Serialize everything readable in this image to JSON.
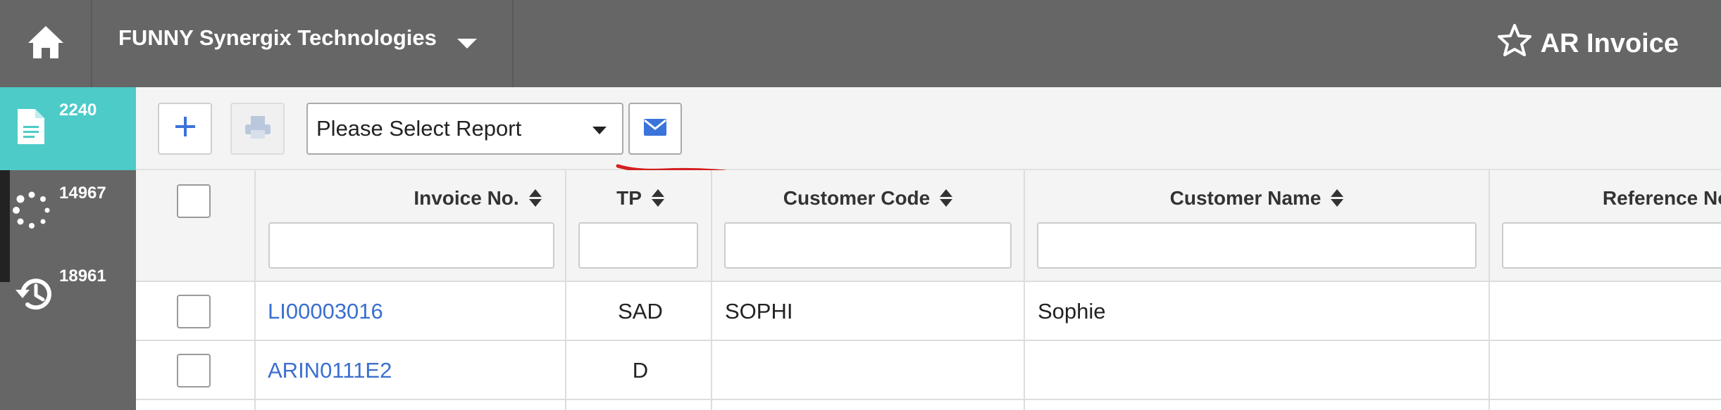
{
  "header": {
    "company_name": "FUNNY Synergix Technologies",
    "page_title": "AR Invoice",
    "icons": {
      "home": "home-icon",
      "company_dropdown": "caret-down-icon",
      "favorite": "star-outline-icon"
    }
  },
  "sidebar": {
    "items": [
      {
        "icon": "document-icon",
        "count": "2240",
        "active": true
      },
      {
        "icon": "spinner-icon",
        "count": "14967",
        "active": false
      },
      {
        "icon": "history-icon",
        "count": "18961",
        "active": false
      }
    ]
  },
  "toolbar": {
    "add_icon": "plus-icon",
    "print_icon": "printer-icon",
    "report_select": {
      "selected": "Please Select Report"
    },
    "email_icon": "envelope-icon"
  },
  "colors": {
    "header_bg": "#666666",
    "sidebar_active": "#4ccbc8",
    "link": "#3b6fcf",
    "accent_blue": "#3a73d9",
    "annotation_red": "#d42020"
  },
  "grid": {
    "columns": [
      {
        "label": "Invoice No."
      },
      {
        "label": "TP"
      },
      {
        "label": "Customer Code"
      },
      {
        "label": "Customer Name"
      },
      {
        "label": "Reference No."
      }
    ],
    "rows": [
      {
        "invoice_no": "LI00003016",
        "tp": "SAD",
        "customer_code": "SOPHI",
        "customer_name": "Sophie",
        "reference_no": ""
      },
      {
        "invoice_no": "ARIN0111E2",
        "tp": "D",
        "customer_code": "",
        "customer_name": "",
        "reference_no": ""
      }
    ]
  }
}
